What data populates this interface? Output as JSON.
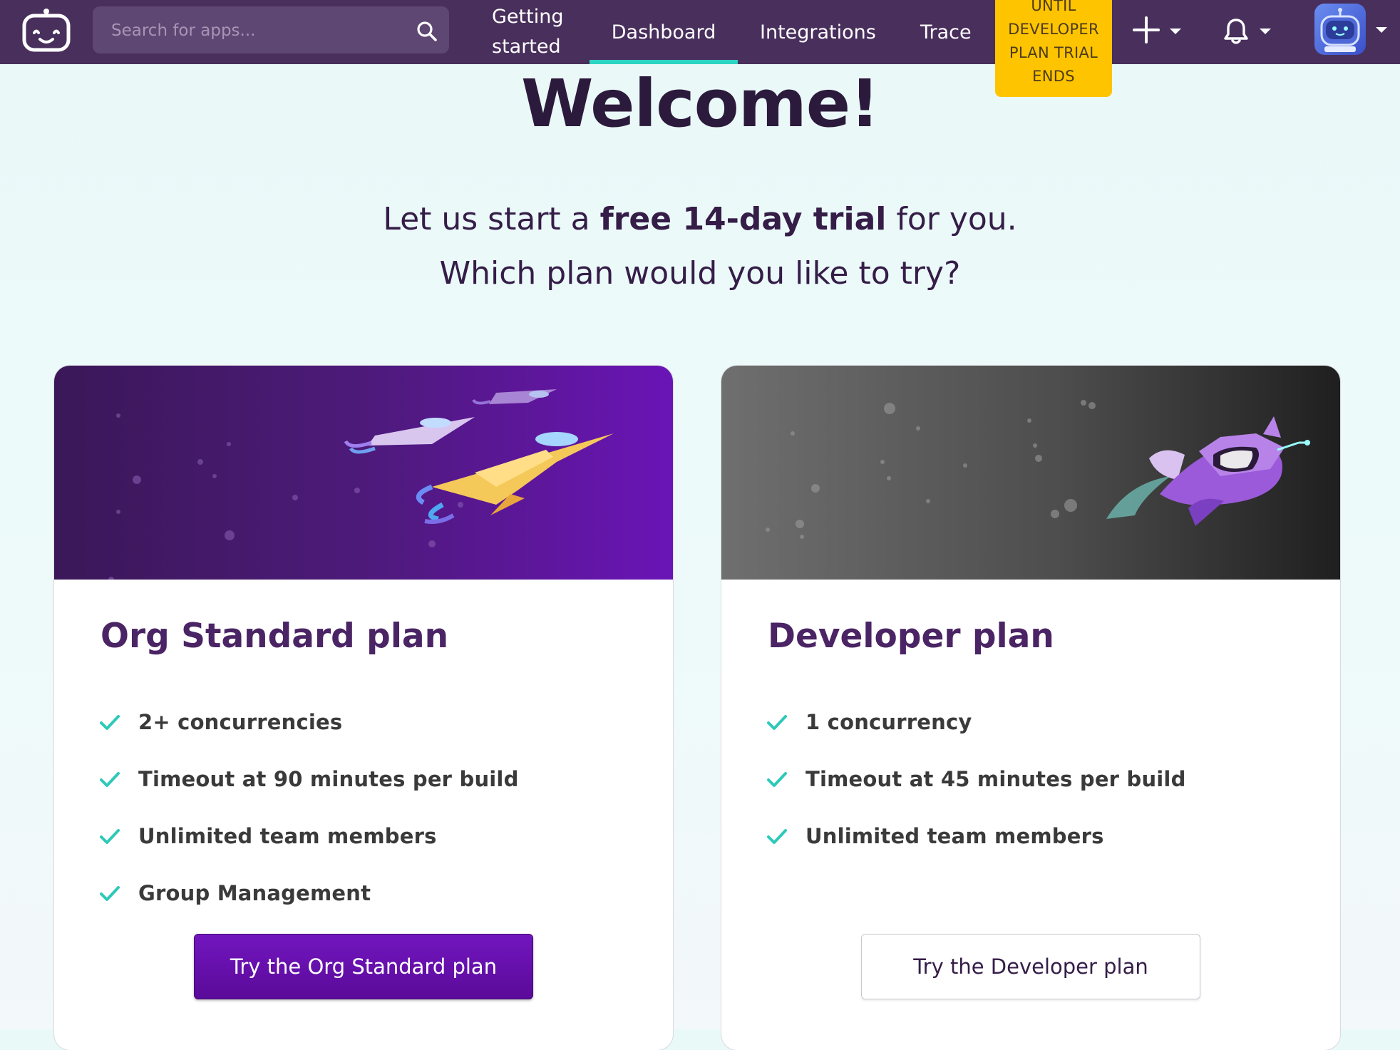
{
  "nav": {
    "search_placeholder": "Search for apps...",
    "getting_started_line1": "Getting",
    "getting_started_line2": "started",
    "dashboard": "Dashboard",
    "integrations": "Integrations",
    "trace": "Trace",
    "trial_badge_lines": [
      "UNTIL",
      "DEVELOPER",
      "PLAN TRIAL",
      "ENDS"
    ],
    "active_tab": "Dashboard",
    "colors": {
      "bar": "#492f5c",
      "accent": "#2dd4c3",
      "badge": "#ffc400"
    }
  },
  "hero": {
    "title": "Welcome!",
    "line1_pre": "Let us start a ",
    "line1_bold": "free 14-day trial",
    "line1_post": " for you.",
    "line2": "Which plan would you like to try?"
  },
  "plans": [
    {
      "title": "Org Standard plan",
      "features": [
        "2+ concurrencies",
        "Timeout at 90 minutes per build",
        "Unlimited team members",
        "Group Management"
      ],
      "button": "Try the Org Standard plan",
      "illustration": "rocket-ships-icon"
    },
    {
      "title": "Developer plan",
      "features": [
        "1 concurrency",
        "Timeout at 45 minutes per build",
        "Unlimited team members"
      ],
      "button": "Try the Developer plan",
      "illustration": "spaceship-icon"
    }
  ]
}
